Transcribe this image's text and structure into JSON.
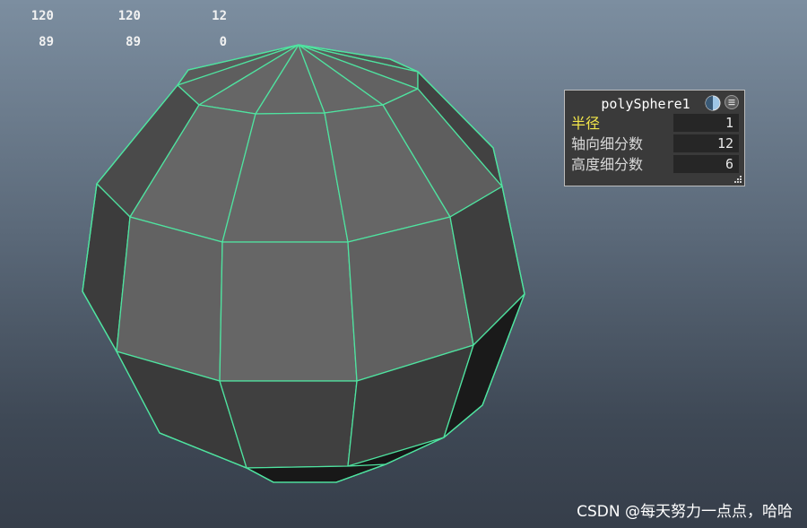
{
  "hud": {
    "row1": [
      "120",
      "120",
      "12"
    ],
    "row2": [
      "89",
      "89",
      "0"
    ]
  },
  "viewport": {
    "wireframe_color": "#4fe3a0",
    "face_light": "#666666",
    "face_dark": "#3c3c3c",
    "face_darkest": "#161616"
  },
  "panel": {
    "title": "polySphere1",
    "rows": [
      {
        "label": "半径",
        "value": "1"
      },
      {
        "label": "轴向细分数",
        "value": "12"
      },
      {
        "label": "高度细分数",
        "value": "6"
      }
    ]
  },
  "watermark": "CSDN @每天努力一点点，哈哈"
}
